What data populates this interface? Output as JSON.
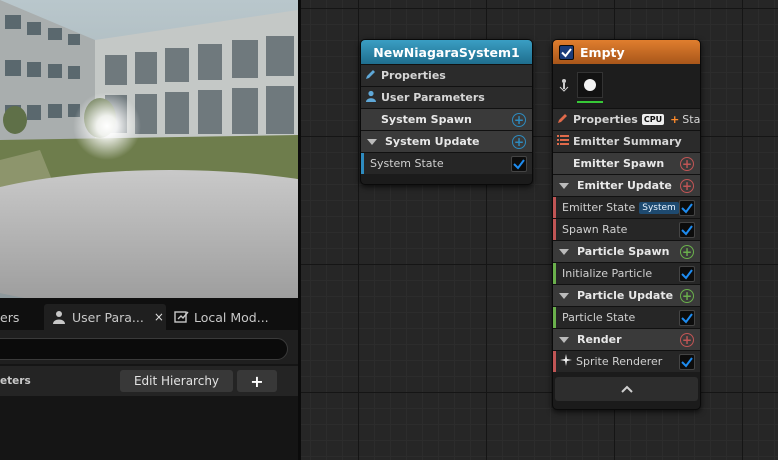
{
  "tabs": {
    "partial_label": "ers",
    "user_params": "User Para...",
    "close_glyph": "×",
    "local_mod": "Local Mod..."
  },
  "params_panel": {
    "header_label": "eters",
    "edit_hierarchy": "Edit Hierarchy",
    "add_glyph": "+"
  },
  "system_node": {
    "title": "NewNiagaraSystem1",
    "rows": {
      "properties": "Properties",
      "user_parameters": "User Parameters",
      "system_spawn": "System Spawn",
      "system_update": "System Update",
      "system_state": "System State"
    }
  },
  "emitter_node": {
    "title": "Empty",
    "properties": "Properties",
    "cpu_badge": "CPU",
    "stage": "Stage",
    "emitter_summary": "Emitter Summary",
    "emitter_spawn": "Emitter Spawn",
    "emitter_update": "Emitter Update",
    "emitter_state": "Emitter State",
    "system_badge": "System",
    "spawn_rate": "Spawn Rate",
    "particle_spawn": "Particle Spawn",
    "initialize_particle": "Initialize Particle",
    "particle_update": "Particle Update",
    "particle_state": "Particle State",
    "render": "Render",
    "sprite_renderer": "Sprite Renderer",
    "collapse_glyph": "^"
  },
  "colors": {
    "system_header": "#2a86ad",
    "emitter_header": "#c8692a",
    "spawn_add": "#c05555",
    "particle_add": "#6ab04c",
    "system_add": "#2e8bbf",
    "checkbox": "#1e8cf0"
  }
}
